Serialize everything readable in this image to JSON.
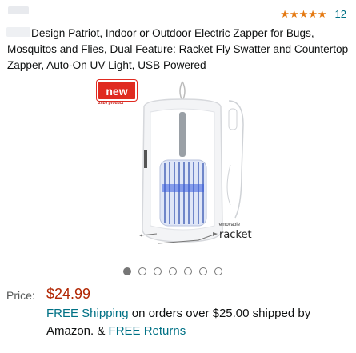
{
  "rating": {
    "stars": [
      "★",
      "★",
      "★",
      "★",
      "★"
    ],
    "count": "12"
  },
  "title": "Design Patriot, Indoor or Outdoor Electric Zapper for Bugs, Mosquitos and Flies, Dual Feature: Racket Fly Swatter and Countertop Zapper, Auto-On UV Light, USB Powered",
  "image": {
    "badge": "new",
    "badge_sub": "2020 product",
    "removable": "removable",
    "racket": "racket"
  },
  "carousel": {
    "total": 7,
    "active_index": 0
  },
  "price": {
    "label": "Price:",
    "value": "$24.99"
  },
  "shipping": {
    "free_shipping": "FREE Shipping",
    "middle": " on orders over $25.00 shipped by Amazon. & ",
    "free_returns": "FREE Returns"
  },
  "colors": {
    "star": "#e47911",
    "link": "#007185",
    "price": "#b12704",
    "badge": "#e02a20"
  }
}
